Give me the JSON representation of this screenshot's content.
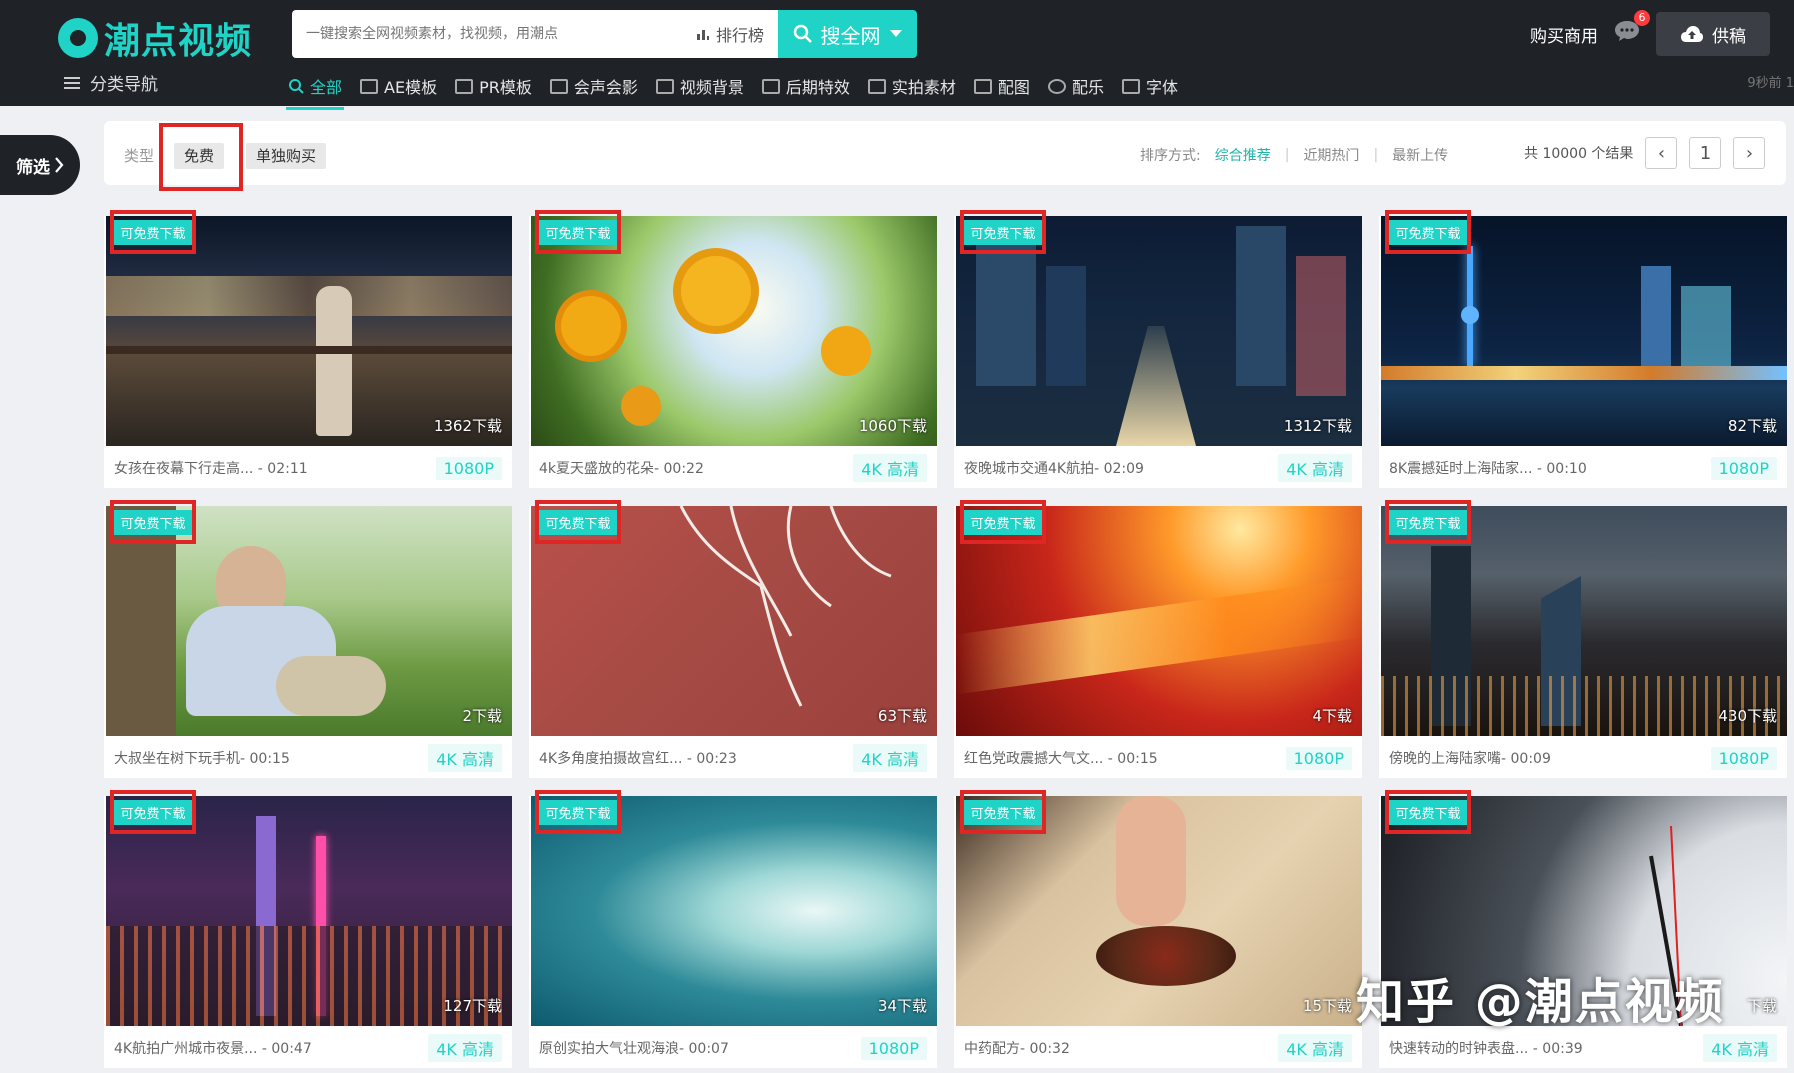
{
  "header": {
    "logo_text": "潮点视频",
    "search_placeholder": "一键搜索全网视频素材，找视频，用潮点",
    "rank_label": "排行榜",
    "search_button": "搜全网",
    "buy_label": "购买商用",
    "message_count": "6",
    "upload_label": "供稿",
    "category_nav": "分类导航",
    "time_ago": "9秒前 1",
    "brand_color": "#1fd3c6"
  },
  "nav": [
    {
      "label": "全部",
      "icon": "search-icon",
      "active": true
    },
    {
      "label": "AE模板",
      "icon": "ae-icon"
    },
    {
      "label": "PR模板",
      "icon": "pr-icon"
    },
    {
      "label": "会声会影",
      "icon": "video-editor-icon"
    },
    {
      "label": "视频背景",
      "icon": "background-icon"
    },
    {
      "label": "后期特效",
      "icon": "effects-icon"
    },
    {
      "label": "实拍素材",
      "icon": "camera-icon"
    },
    {
      "label": "配图",
      "icon": "image-icon"
    },
    {
      "label": "配乐",
      "icon": "music-icon"
    },
    {
      "label": "字体",
      "icon": "font-icon"
    }
  ],
  "filter": {
    "tab_label": "筛选",
    "type_label": "类型",
    "chips": [
      "免费",
      "单独购买"
    ],
    "sort_label": "排序方式:",
    "sort_options": [
      "综合推荐",
      "近期热门",
      "最新上传"
    ],
    "result_count": "共 10000 个结果",
    "page": "1"
  },
  "cards": [
    {
      "badge": "可免费下载",
      "downloads": "1362下载",
      "title": "女孩在夜幕下行走高... - 02:11",
      "res": "1080P"
    },
    {
      "badge": "可免费下载",
      "downloads": "1060下载",
      "title": "4k夏天盛放的花朵- 00:22",
      "res": "4K 高清"
    },
    {
      "badge": "可免费下载",
      "downloads": "1312下载",
      "title": "夜晚城市交通4K航拍- 02:09",
      "res": "4K 高清"
    },
    {
      "badge": "可免费下载",
      "downloads": "82下载",
      "title": "8K震撼延时上海陆家... - 00:10",
      "res": "1080P"
    },
    {
      "badge": "可免费下载",
      "downloads": "2下载",
      "title": "大叔坐在树下玩手机- 00:15",
      "res": "4K 高清"
    },
    {
      "badge": "可免费下载",
      "downloads": "63下载",
      "title": "4K多角度拍摄故宫红... - 00:23",
      "res": "4K 高清"
    },
    {
      "badge": "可免费下载",
      "downloads": "4下载",
      "title": "红色党政震撼大气文... - 00:15",
      "res": "1080P"
    },
    {
      "badge": "可免费下载",
      "downloads": "430下载",
      "title": "傍晚的上海陆家嘴- 00:09",
      "res": "1080P"
    },
    {
      "badge": "可免费下载",
      "downloads": "127下载",
      "title": "4K航拍广州城市夜景... - 00:47",
      "res": "4K 高清"
    },
    {
      "badge": "可免费下载",
      "downloads": "34下载",
      "title": "原创实拍大气壮观海浪- 00:07",
      "res": "1080P"
    },
    {
      "badge": "可免费下载",
      "downloads": "15下载",
      "title": "中药配方- 00:32",
      "res": "4K 高清"
    },
    {
      "badge": "可免费下载",
      "downloads": "下载",
      "title": "快速转动的时钟表盘... - 00:39",
      "res": "4K 高清"
    }
  ],
  "watermark": "知乎 @潮点视频"
}
